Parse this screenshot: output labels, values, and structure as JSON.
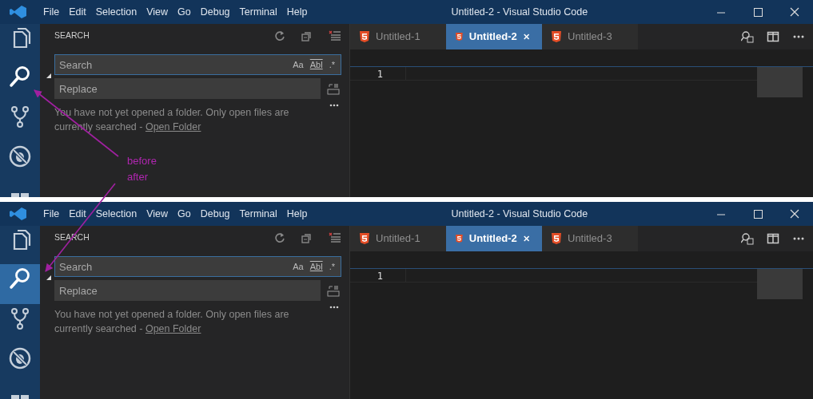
{
  "panels": [
    {
      "menu": [
        "File",
        "Edit",
        "Selection",
        "View",
        "Go",
        "Debug",
        "Terminal",
        "Help"
      ],
      "title": "Untitled-2 - Visual Studio Code",
      "highlight_selected": false,
      "activity_bar": [
        {
          "kind": "explorer",
          "selected": false
        },
        {
          "kind": "search",
          "selected": true
        },
        {
          "kind": "source-control",
          "selected": false
        },
        {
          "kind": "debug",
          "selected": false
        },
        {
          "kind": "extensions",
          "selected": false
        }
      ],
      "sidebar": {
        "title": "SEARCH",
        "search": {
          "placeholder": "Search",
          "options": [
            "Aa",
            "Abl",
            ".*"
          ]
        },
        "replace": {
          "placeholder": "Replace"
        },
        "message": "You have not yet opened a folder. Only open files are currently searched -",
        "link": "Open Folder"
      },
      "tabs": [
        {
          "label": "Untitled-1",
          "selected": false
        },
        {
          "label": "Untitled-2",
          "selected": true
        },
        {
          "label": "Untitled-3",
          "selected": false
        }
      ],
      "line_numbers": [
        "1"
      ]
    },
    {
      "menu": [
        "File",
        "Edit",
        "Selection",
        "View",
        "Go",
        "Debug",
        "Terminal",
        "Help"
      ],
      "title": "Untitled-2 - Visual Studio Code",
      "highlight_selected": true,
      "activity_bar": [
        {
          "kind": "explorer",
          "selected": false
        },
        {
          "kind": "search",
          "selected": true
        },
        {
          "kind": "source-control",
          "selected": false
        },
        {
          "kind": "debug",
          "selected": false
        },
        {
          "kind": "extensions",
          "selected": false
        }
      ],
      "sidebar": {
        "title": "SEARCH",
        "search": {
          "placeholder": "Search",
          "options": [
            "Aa",
            "Abl",
            ".*"
          ]
        },
        "replace": {
          "placeholder": "Replace"
        },
        "message": "You have not yet opened a folder. Only open files are currently searched -",
        "link": "Open Folder"
      },
      "tabs": [
        {
          "label": "Untitled-1",
          "selected": false
        },
        {
          "label": "Untitled-2",
          "selected": true
        },
        {
          "label": "Untitled-3",
          "selected": false
        }
      ],
      "line_numbers": [
        "1"
      ]
    }
  ],
  "annotations": [
    {
      "text": "before"
    },
    {
      "text": "after"
    }
  ]
}
